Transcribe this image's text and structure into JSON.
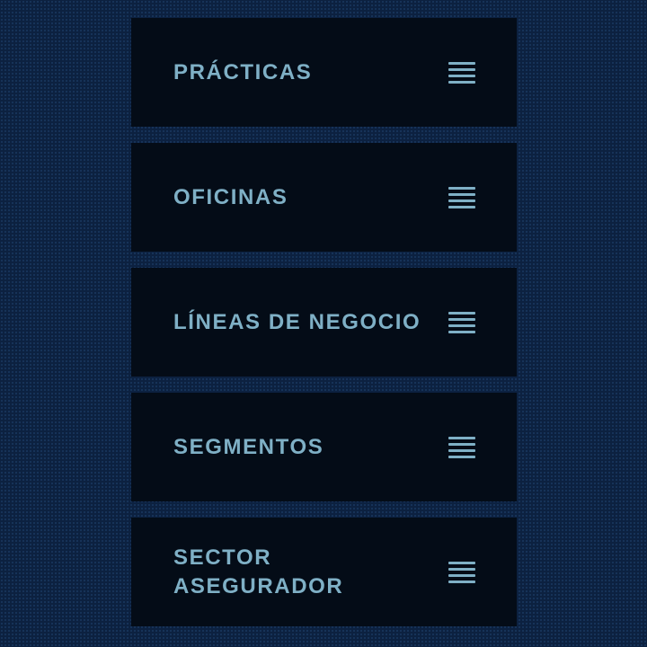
{
  "menu": {
    "items": [
      {
        "label": "PRÁCTICAS",
        "icon": "hamburger-icon"
      },
      {
        "label": "OFICINAS",
        "icon": "hamburger-icon"
      },
      {
        "label": "LÍNEAS DE NEGOCIO",
        "icon": "hamburger-icon"
      },
      {
        "label": "SEGMENTOS",
        "icon": "hamburger-icon"
      },
      {
        "label": "SECTOR ASEGURADOR",
        "icon": "hamburger-icon"
      }
    ]
  },
  "colors": {
    "background": "#0c2140",
    "card": "#040c17",
    "accent": "#7fb0c6"
  }
}
